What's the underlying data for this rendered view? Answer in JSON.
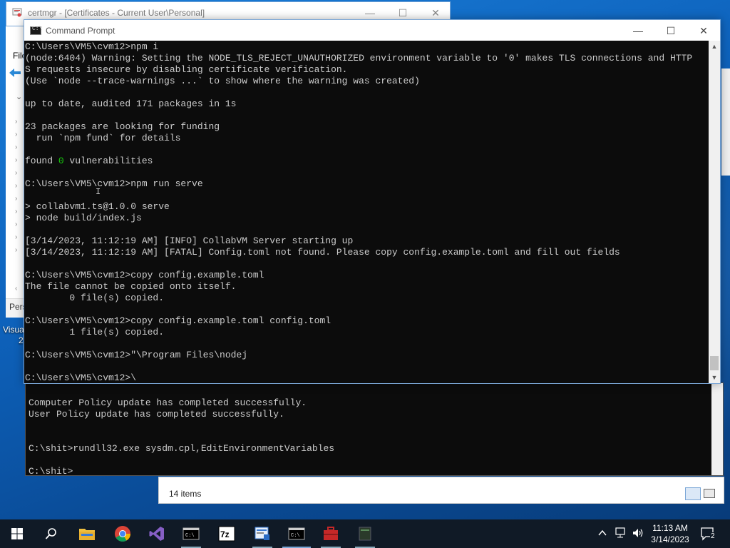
{
  "certmgr": {
    "title": "certmgr - [Certificates - Current User\\Personal]",
    "menu_file": "File",
    "tree_label": "Pers",
    "status_items": "14 items"
  },
  "desktop": {
    "icon_label_line1": "Visua",
    "icon_label_line2": "2"
  },
  "cmd": {
    "title": "Command Prompt",
    "icon_text": "C:\\",
    "lines": [
      "C:\\Users\\VM5\\cvm12>npm i",
      "(node:6404) Warning: Setting the NODE_TLS_REJECT_UNAUTHORIZED environment variable to '0' makes TLS connections and HTTP",
      "S requests insecure by disabling certificate verification.",
      "(Use `node --trace-warnings ...` to show where the warning was created)",
      "",
      "up to date, audited 171 packages in 1s",
      "",
      "23 packages are looking for funding",
      "  run `npm fund` for details",
      "",
      "found ",
      "",
      "C:\\Users\\VM5\\cvm12>npm run serve",
      "",
      "> collabvm1.ts@1.0.0 serve",
      "> node build/index.js",
      "",
      "[3/14/2023, 11:12:19 AM] [INFO] CollabVM Server starting up",
      "[3/14/2023, 11:12:19 AM] [FATAL] Config.toml not found. Please copy config.example.toml and fill out fields",
      "",
      "C:\\Users\\VM5\\cvm12>copy config.example.toml",
      "The file cannot be copied onto itself.",
      "        0 file(s) copied.",
      "",
      "C:\\Users\\VM5\\cvm12>copy config.example.toml config.toml",
      "        1 file(s) copied.",
      "",
      "C:\\Users\\VM5\\cvm12>\"\\Program Files\\nodej",
      "",
      "C:\\Users\\VM5\\cvm12>\\"
    ],
    "found_count": "0",
    "found_suffix": " vulnerabilities"
  },
  "console2": {
    "lines": [
      "Computer Policy update has completed successfully.",
      "User Policy update has completed successfully.",
      "",
      "",
      "C:\\shit>rundll32.exe sysdm.cpl,EditEnvironmentVariables",
      "",
      "C:\\shit>"
    ]
  },
  "taskbar": {
    "time": "11:13 AM",
    "date": "3/14/2023",
    "notification_count": "2",
    "apps": [
      "start-icon",
      "search-icon",
      "file-explorer-icon",
      "chrome-icon",
      "visual-studio-icon",
      "command-prompt-icon",
      "7zip-icon",
      "certmgr-icon",
      "command-prompt-icon",
      "toolbox-icon",
      "terminal-icon"
    ]
  },
  "colors": {
    "accent": "#0e63bd",
    "console_bg": "#0c0c0c",
    "console_fg": "#cccccc",
    "green": "#16c60c",
    "taskbar": "#101a26"
  }
}
